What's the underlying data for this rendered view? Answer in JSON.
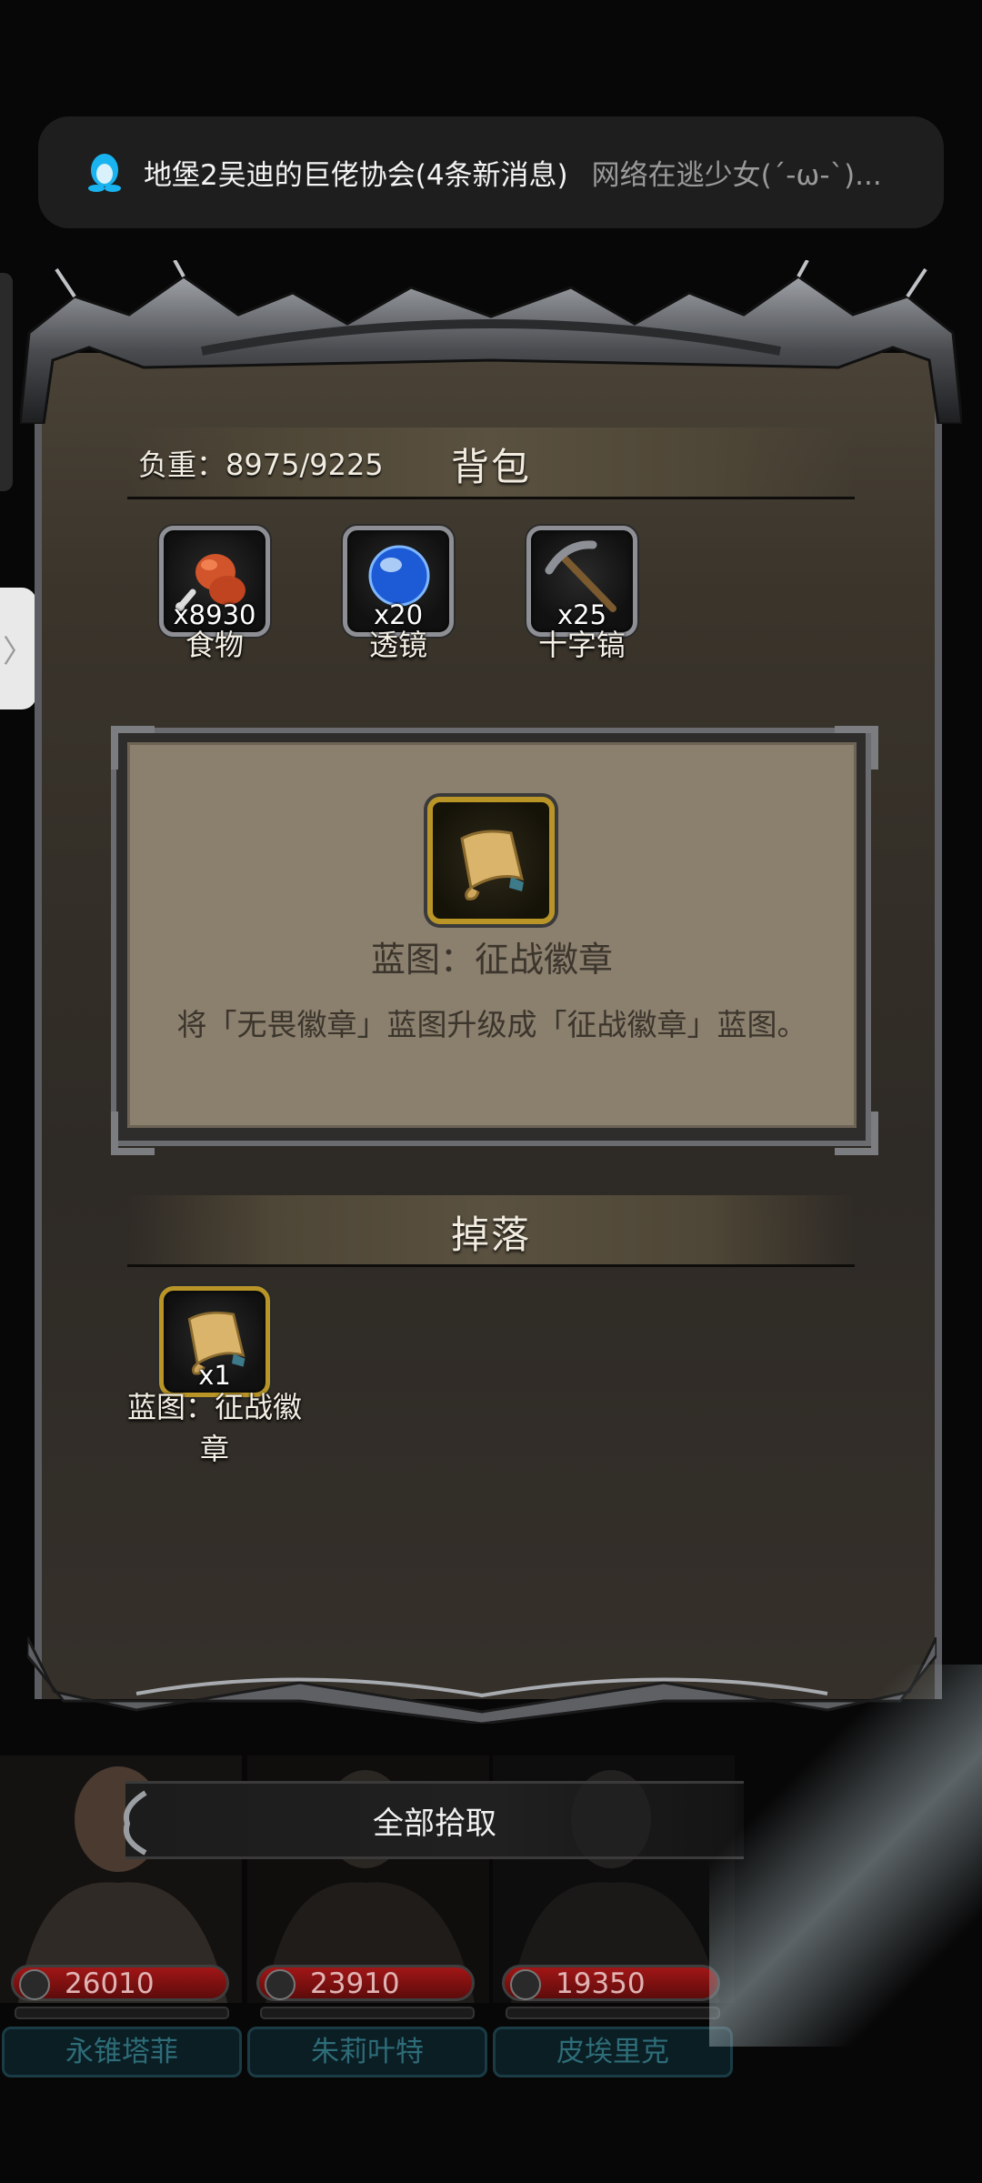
{
  "notification": {
    "title": "地堡2吴迪的巨佬协会(4条新消息)",
    "message": "网络在逃少女(´-ω-`)..."
  },
  "backpack": {
    "title": "背包",
    "weight_label": "负重：8975/9225",
    "items": [
      {
        "name": "食物",
        "count": "x8930",
        "icon": "meat-icon"
      },
      {
        "name": "透镜",
        "count": "x20",
        "icon": "lens-icon"
      },
      {
        "name": "十字镐",
        "count": "x25",
        "icon": "pickaxe-icon"
      }
    ]
  },
  "detail": {
    "icon": "scroll-icon",
    "title": "蓝图：征战徽章",
    "description": "将「无畏徽章」蓝图升级成「征战徽章」蓝图。"
  },
  "drops": {
    "title": "掉落",
    "items": [
      {
        "name": "蓝图：征战徽章",
        "count": "x1",
        "icon": "scroll-icon"
      }
    ]
  },
  "pickup_all_label": "全部拾取",
  "heroes": [
    {
      "name": "永锥塔菲",
      "hp": "26010"
    },
    {
      "name": "朱莉叶特",
      "hp": "23910"
    },
    {
      "name": "皮埃里克",
      "hp": "19350"
    }
  ],
  "colors": {
    "hp_bar": "#a11616",
    "rare_border": "#b99528",
    "card_bg": "#8b7f6e"
  }
}
